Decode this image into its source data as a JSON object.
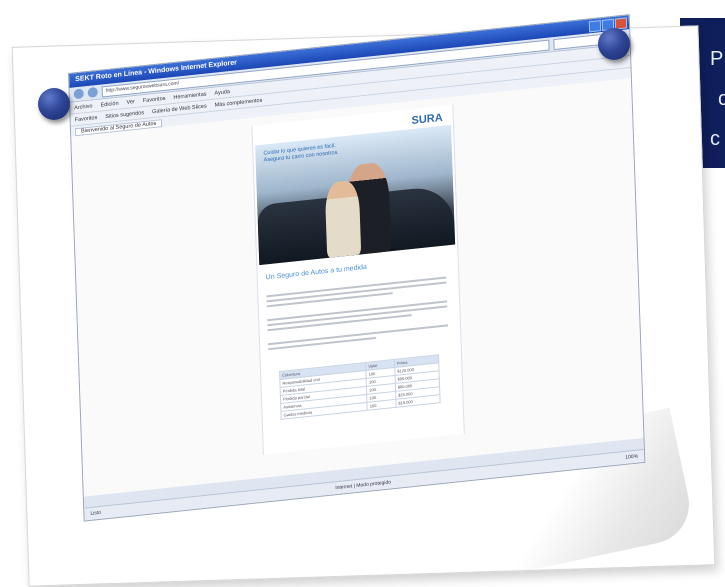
{
  "side_text": {
    "line1": "P",
    "line2": "c",
    "line3": "c"
  },
  "browser": {
    "title": "SEKT Roto en Línea - Windows Internet Explorer",
    "url": "http://www.seguroswebsura.com/",
    "menu": [
      "Archivo",
      "Edición",
      "Ver",
      "Favoritos",
      "Herramientas",
      "Ayuda"
    ],
    "toolbar": [
      "Favoritos",
      "Sitios sugeridos",
      "Galería de Web Slices",
      "Más complementos"
    ],
    "tab_label": "Bienvenido al Seguro de Autos",
    "page": {
      "logo": "SURA",
      "hero_text": "Cuidar lo que quieres es fácil. Asegura tu carro con nosotros.",
      "article_title": "Un Seguro de Autos a tu medida",
      "table_header": [
        "Cobertura",
        "Valor",
        "Prima"
      ],
      "table_rows": [
        [
          "Responsabilidad civil",
          "100",
          "$120.000"
        ],
        [
          "Pérdida total",
          "100",
          "$95.000"
        ],
        [
          "Pérdida parcial",
          "100",
          "$60.000"
        ],
        [
          "Asistencia",
          "100",
          "$25.000"
        ],
        [
          "Gastos médicos",
          "100",
          "$15.000"
        ]
      ]
    },
    "status_left": "Listo",
    "status_zone": "Internet | Modo protegido",
    "zoom": "100%"
  }
}
